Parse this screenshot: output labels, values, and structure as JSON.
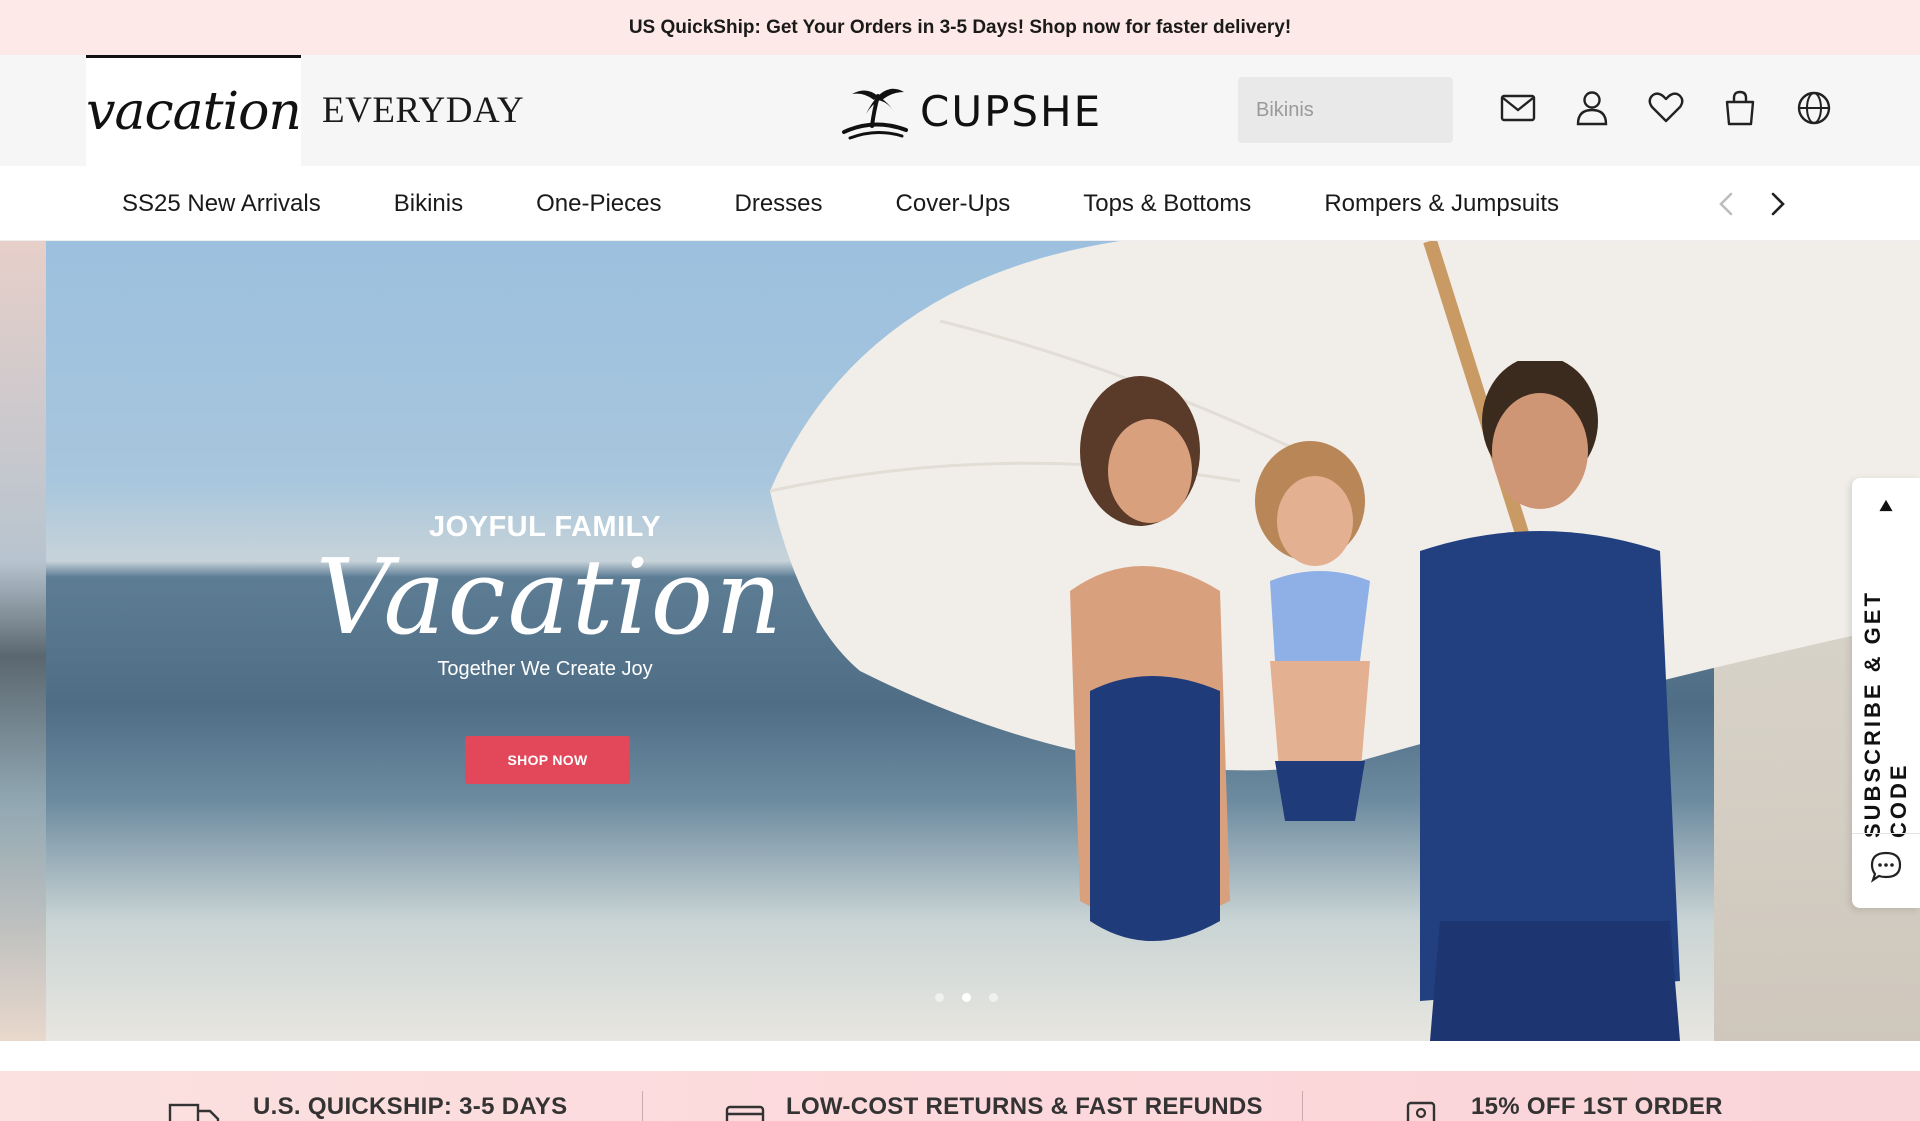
{
  "announcement": {
    "text": "US QuickShip: Get Your Orders in 3-5 Days! Shop now for faster delivery!"
  },
  "header": {
    "tabs": [
      {
        "label": "vacation",
        "active": true
      },
      {
        "label": "EVERYDAY",
        "active": false
      }
    ],
    "brand": "CUPSHE",
    "search": {
      "placeholder": "Bikinis"
    },
    "icons": [
      "mail-icon",
      "account-icon",
      "wishlist-icon",
      "cart-icon",
      "globe-icon"
    ]
  },
  "nav": {
    "items": [
      "SS25 New Arrivals",
      "Bikinis",
      "One-Pieces",
      "Dresses",
      "Cover-Ups",
      "Tops & Bottoms",
      "Rompers & Jumpsuits"
    ]
  },
  "hero": {
    "kicker": "JOYFUL FAMILY",
    "script": "Vacation",
    "subtitle": "Together We Create Joy",
    "cta": "SHOP NOW",
    "slides": 3,
    "active_slide": 2
  },
  "side_panel": {
    "label": "SUBSCRIBE & GET CODE"
  },
  "benefits": [
    {
      "icon": "truck-icon",
      "label": "U.S. QUICKSHIP: 3-5 DAYS"
    },
    {
      "icon": "card-icon",
      "label": "LOW-COST RETURNS & FAST REFUNDS"
    },
    {
      "icon": "coupon-icon",
      "label": "15% OFF 1ST ORDER"
    }
  ],
  "colors": {
    "announcement_bg": "#fde9e8",
    "cta": "#e2485a",
    "header_bg": "#f6f6f6"
  }
}
